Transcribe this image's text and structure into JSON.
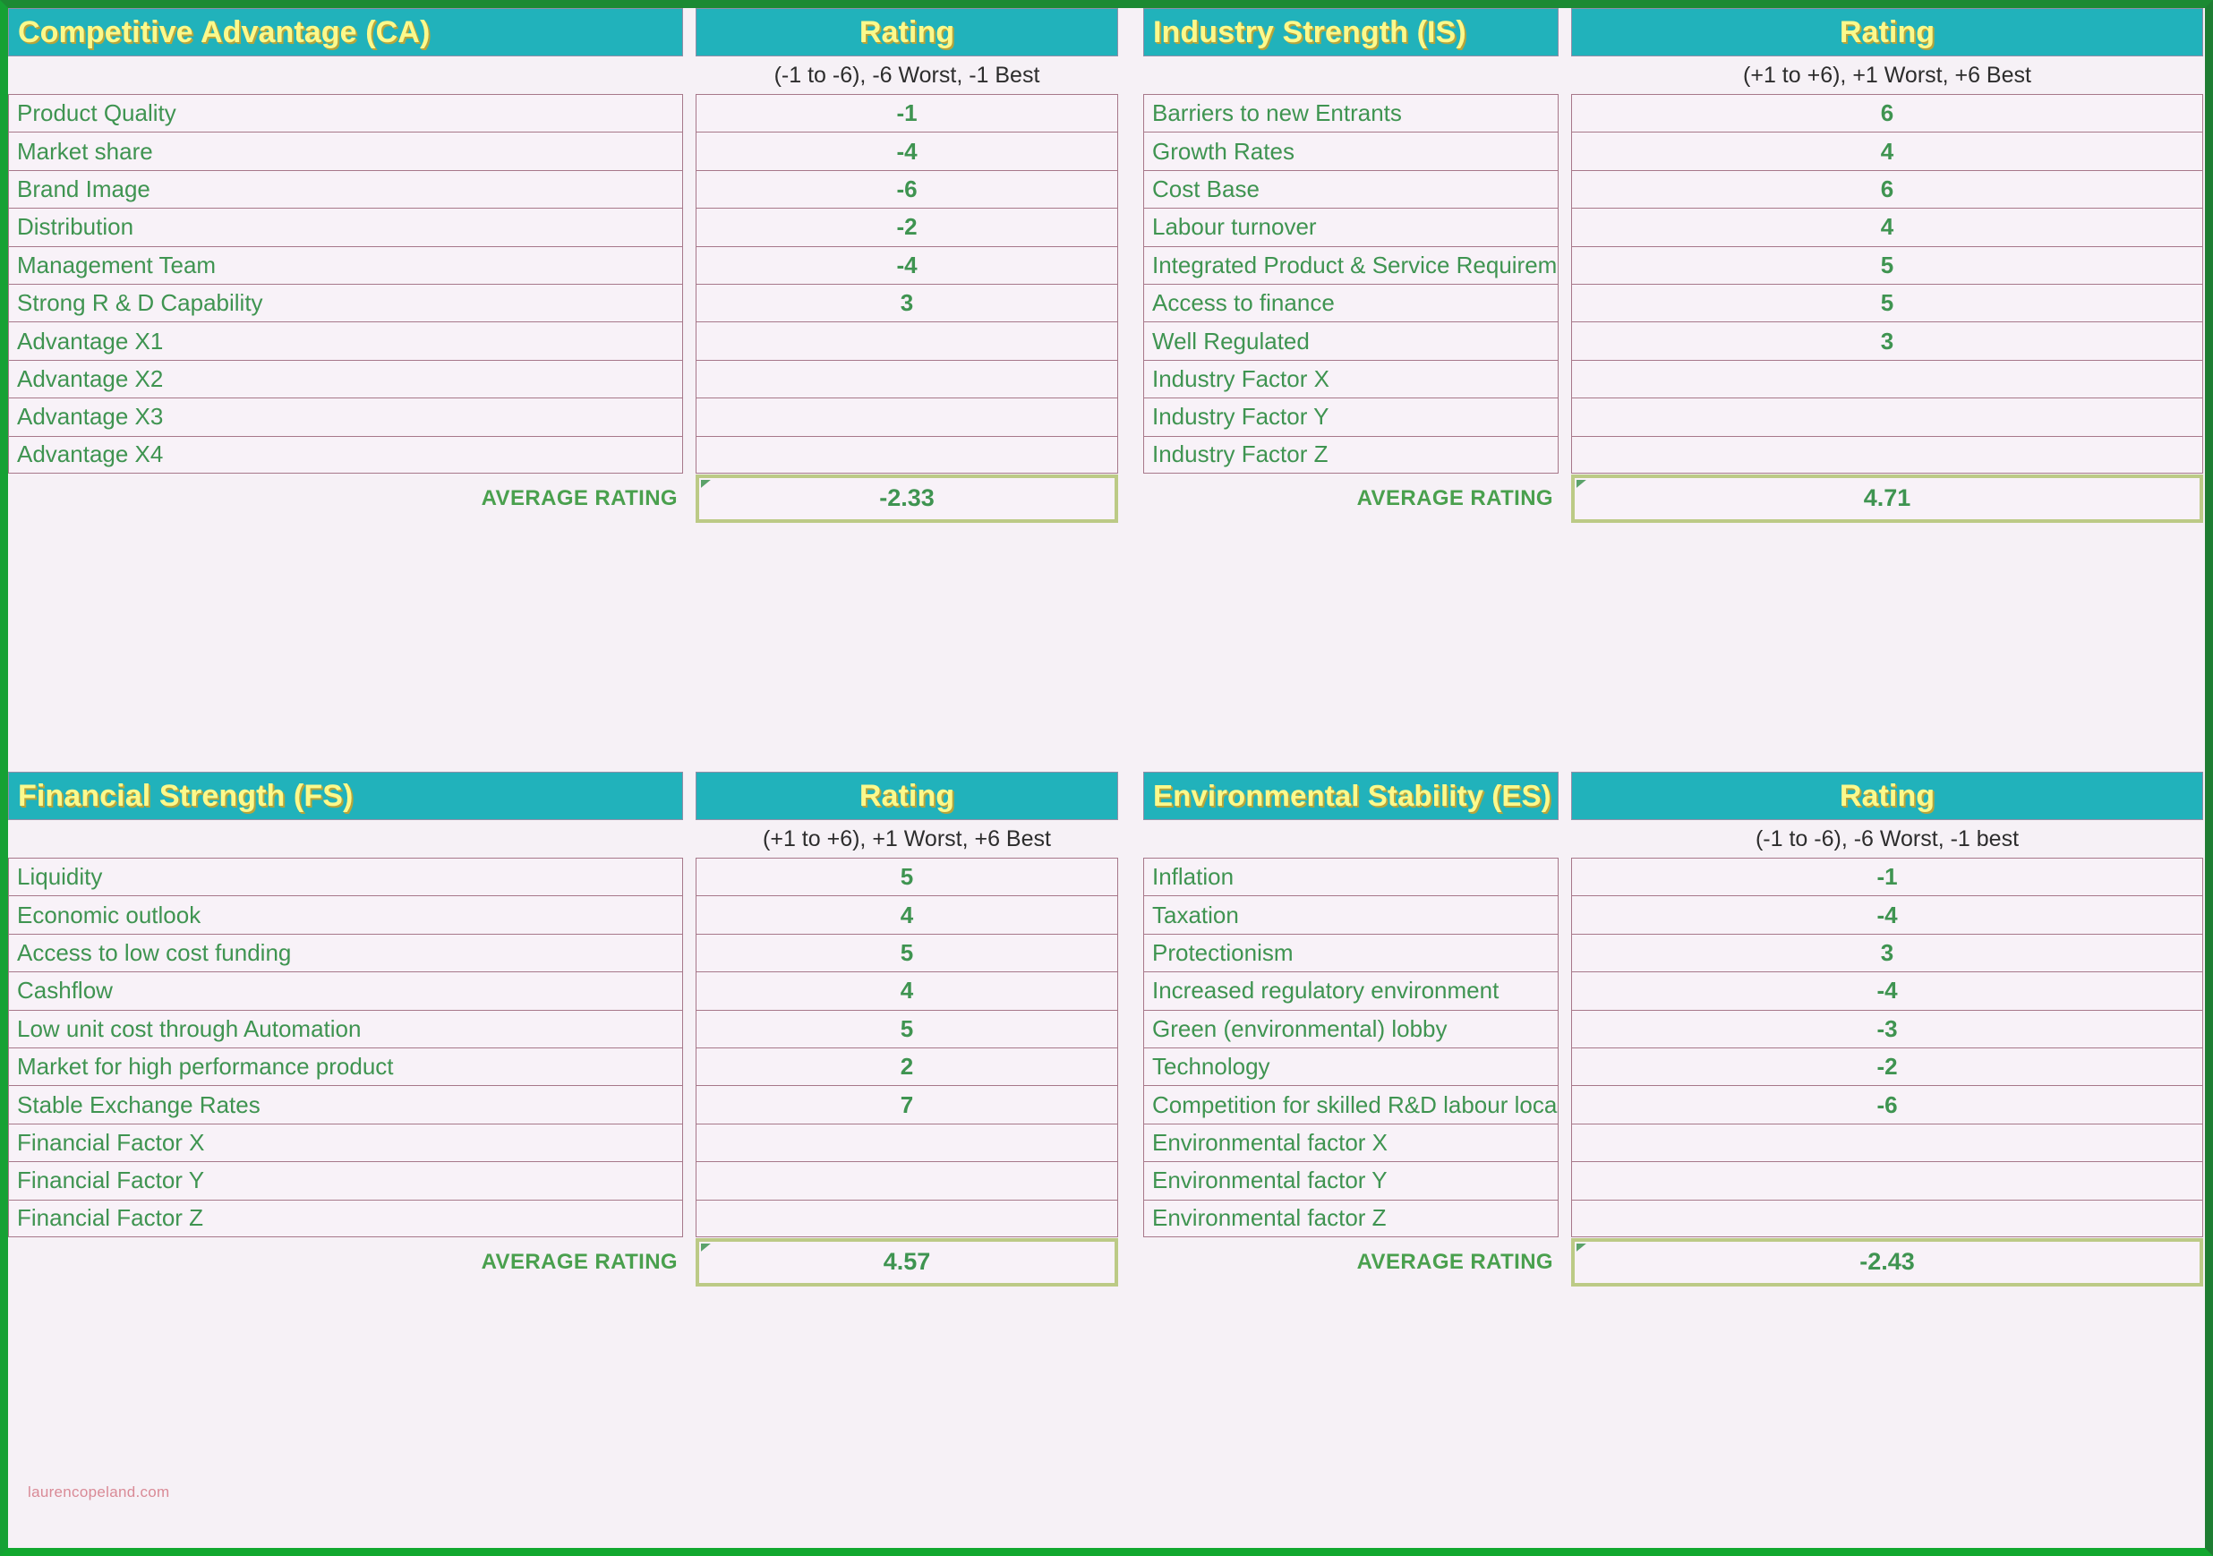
{
  "watermark": "laurencopeland.com",
  "labels": {
    "rating_header": "Rating",
    "average_rating": "AVERAGE RATING"
  },
  "sections": {
    "competitive_advantage": {
      "title": "Competitive Advantage (CA)",
      "rating_header": "Rating",
      "scale": "(-1 to -6), -6 Worst, -1 Best",
      "average_label": "AVERAGE RATING",
      "average": "-2.33",
      "rows": [
        {
          "factor": "Product Quality",
          "rating": "-1"
        },
        {
          "factor": "Market share",
          "rating": "-4"
        },
        {
          "factor": "Brand Image",
          "rating": "-6"
        },
        {
          "factor": "Distribution",
          "rating": "-2"
        },
        {
          "factor": "Management Team",
          "rating": "-4"
        },
        {
          "factor": "Strong R & D Capability",
          "rating": "3"
        },
        {
          "factor": "Advantage X1",
          "rating": ""
        },
        {
          "factor": "Advantage X2",
          "rating": ""
        },
        {
          "factor": "Advantage X3",
          "rating": ""
        },
        {
          "factor": "Advantage X4",
          "rating": ""
        }
      ]
    },
    "industry_strength": {
      "title": "Industry Strength (IS)",
      "rating_header": "Rating",
      "scale": "(+1 to +6), +1 Worst, +6 Best",
      "average_label": "AVERAGE RATING",
      "average": "4.71",
      "rows": [
        {
          "factor": "Barriers to new Entrants",
          "rating": "6"
        },
        {
          "factor": "Growth Rates",
          "rating": "4"
        },
        {
          "factor": "Cost Base",
          "rating": "6"
        },
        {
          "factor": "Labour turnover",
          "rating": "4"
        },
        {
          "factor": "Integrated Product & Service Requirement",
          "rating": "5"
        },
        {
          "factor": "Access to finance",
          "rating": "5"
        },
        {
          "factor": "Well Regulated",
          "rating": "3"
        },
        {
          "factor": "Industry Factor X",
          "rating": ""
        },
        {
          "factor": "Industry Factor Y",
          "rating": ""
        },
        {
          "factor": "Industry Factor Z",
          "rating": ""
        }
      ]
    },
    "financial_strength": {
      "title": "Financial Strength (FS)",
      "rating_header": "Rating",
      "scale": "(+1 to +6), +1 Worst, +6 Best",
      "average_label": "AVERAGE RATING",
      "average": "4.57",
      "rows": [
        {
          "factor": "Liquidity",
          "rating": "5"
        },
        {
          "factor": "Economic outlook",
          "rating": "4"
        },
        {
          "factor": "Access to low cost funding",
          "rating": "5"
        },
        {
          "factor": "Cashflow",
          "rating": "4"
        },
        {
          "factor": "Low unit cost through Automation",
          "rating": "5"
        },
        {
          "factor": "Market for high performance product",
          "rating": "2"
        },
        {
          "factor": "Stable Exchange Rates",
          "rating": "7"
        },
        {
          "factor": "Financial Factor X",
          "rating": ""
        },
        {
          "factor": "Financial Factor Y",
          "rating": ""
        },
        {
          "factor": "Financial Factor Z",
          "rating": ""
        }
      ]
    },
    "environmental_stability": {
      "title": "Environmental Stability (ES)",
      "rating_header": "Rating",
      "scale": "(-1 to -6), -6 Worst, -1 best",
      "average_label": "AVERAGE RATING",
      "average": "-2.43",
      "rows": [
        {
          "factor": "Inflation",
          "rating": "-1"
        },
        {
          "factor": "Taxation",
          "rating": "-4"
        },
        {
          "factor": "Protectionism",
          "rating": "3"
        },
        {
          "factor": "Increased regulatory environment",
          "rating": "-4"
        },
        {
          "factor": "Green (environmental) lobby",
          "rating": "-3"
        },
        {
          "factor": "Technology",
          "rating": "-2"
        },
        {
          "factor": "Competition for skilled R&D labour locally",
          "rating": "-6"
        },
        {
          "factor": "Environmental factor X",
          "rating": ""
        },
        {
          "factor": "Environmental factor Y",
          "rating": ""
        },
        {
          "factor": "Environmental factor Z",
          "rating": ""
        }
      ]
    }
  },
  "colors": {
    "header_bg": "#21b2bb",
    "header_text": "#fbf98c",
    "cell_text": "#3f9451",
    "cell_bg": "#f8f2f8",
    "cell_border": "#a7788a",
    "frame": "#16a134",
    "avg_box_border": "#bcca86"
  }
}
